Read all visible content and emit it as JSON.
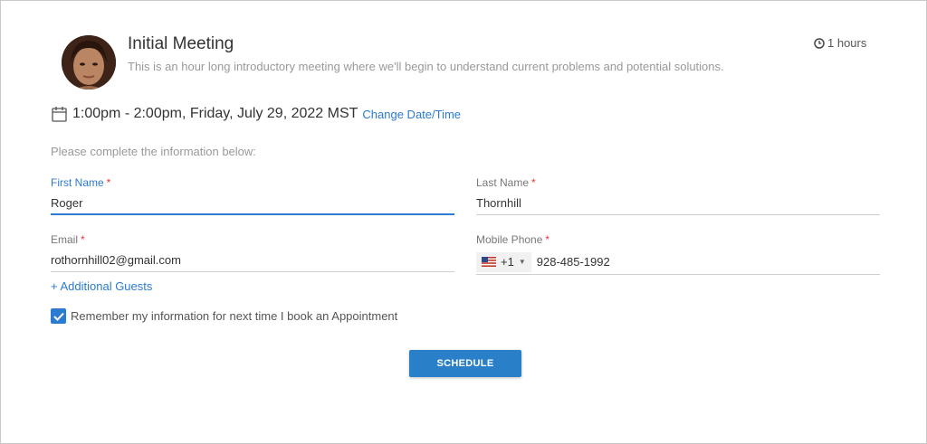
{
  "meeting": {
    "title": "Initial Meeting",
    "description": "This is an hour long introductory meeting where we'll begin to understand current problems and potential solutions.",
    "duration": "1 hours",
    "duration_icon": "clock-icon",
    "avatar_icon": "avatar"
  },
  "schedule": {
    "datetime": "1:00pm - 2:00pm, Friday, July 29, 2022 MST",
    "change_link": "Change Date/Time",
    "calendar_icon": "calendar-icon"
  },
  "form": {
    "instructions": "Please complete the information below:",
    "required_marker": "*",
    "first_name": {
      "label": "First Name",
      "value": "Roger"
    },
    "last_name": {
      "label": "Last Name",
      "value": "Thornhill"
    },
    "email": {
      "label": "Email",
      "value": "rothornhill02@gmail.com"
    },
    "mobile_phone": {
      "label": "Mobile Phone",
      "country_flag": "us-flag-icon",
      "dial_code": "+1",
      "value": "928-485-1992"
    },
    "additional_guests": "+ Additional Guests",
    "remember": {
      "label": "Remember my information for next time I book an Appointment",
      "checked": true
    },
    "submit_label": "SCHEDULE"
  },
  "colors": {
    "accent": "#2b7bd0",
    "button": "#2a7fc9",
    "required": "#e53935",
    "muted_text": "#999999"
  }
}
